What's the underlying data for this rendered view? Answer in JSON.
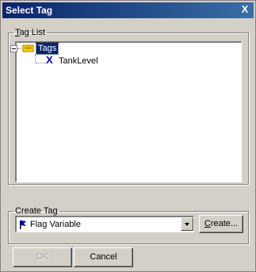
{
  "window": {
    "title": "Select Tag",
    "close_label": "X"
  },
  "tag_list": {
    "legend_accel": "T",
    "legend_rest": "ag List",
    "root": {
      "label": "Tags",
      "icon": "tag-folder-icon",
      "expanded": true
    },
    "children": [
      {
        "label": "TankLevel",
        "icon": "variable-x-icon"
      }
    ]
  },
  "create_tag": {
    "legend": "Create Tag",
    "type_select": {
      "value": "Flag Variable",
      "icon": "flag-icon"
    },
    "create_button_accel": "C",
    "create_button_rest": "reate..."
  },
  "buttons": {
    "ok": "OK",
    "cancel": "Cancel"
  },
  "colors": {
    "titlebar_start": "#0a246a",
    "titlebar_end": "#3a6ea5",
    "selection": "#0a246a",
    "face": "#d4d0c8"
  }
}
